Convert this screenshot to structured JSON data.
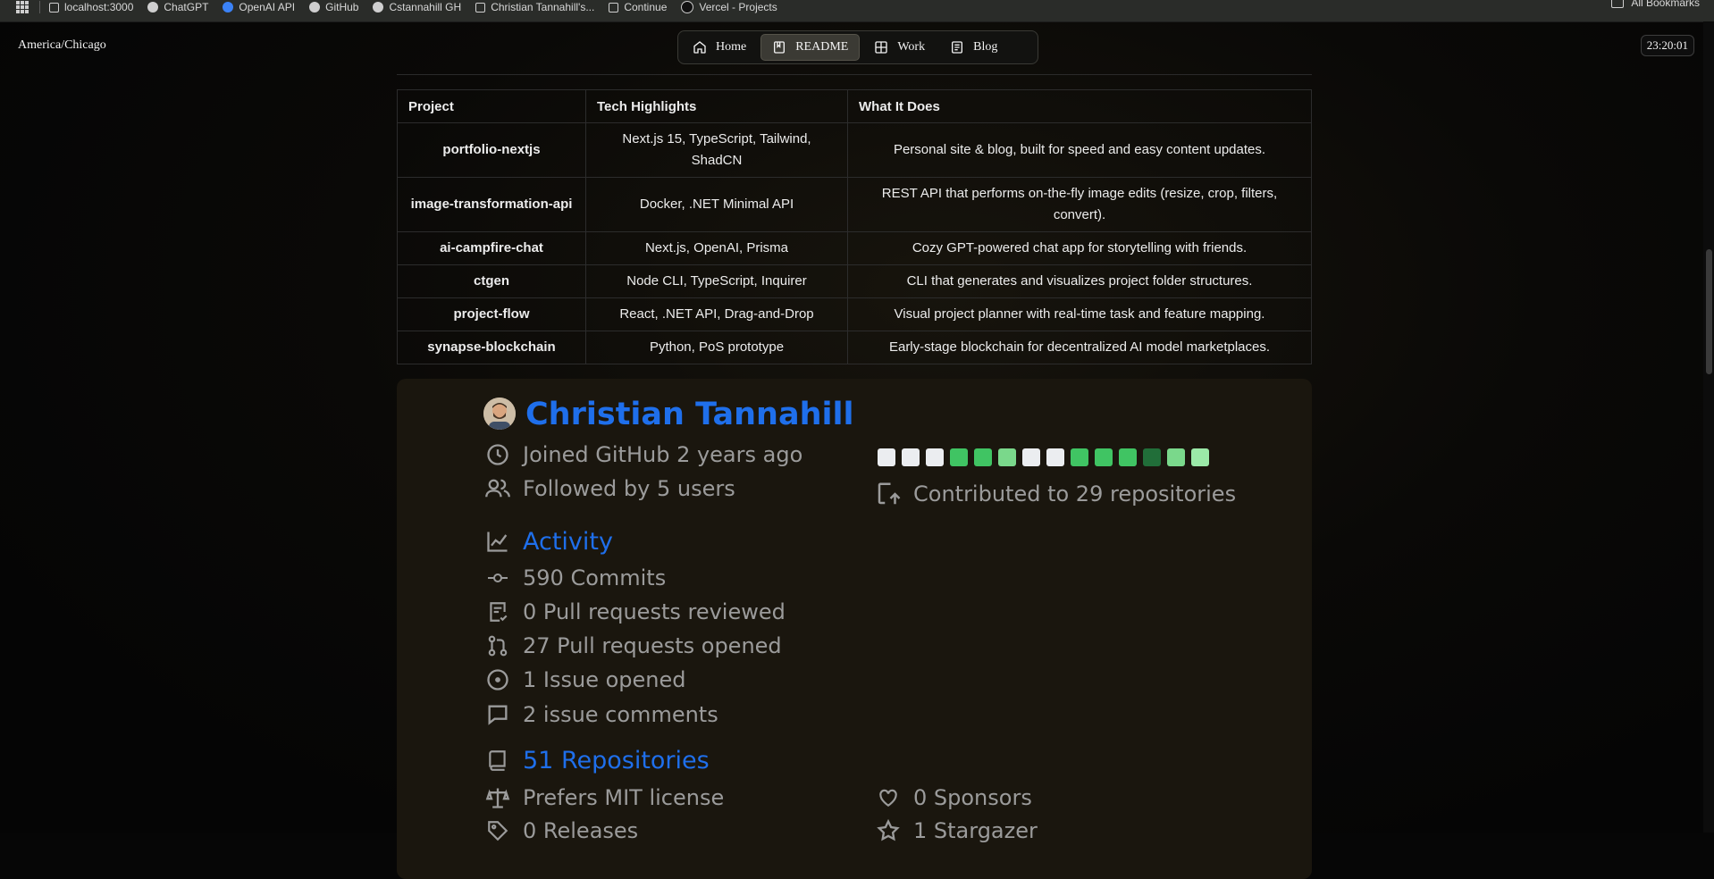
{
  "bookmarks": {
    "items": [
      {
        "label": "localhost:3000",
        "icon": "page-icon"
      },
      {
        "label": "ChatGPT",
        "icon": "openai-icon"
      },
      {
        "label": "OpenAI API",
        "icon": "openai-icon"
      },
      {
        "label": "GitHub",
        "icon": "github-icon"
      },
      {
        "label": "Cstannahill GH",
        "icon": "github-icon"
      },
      {
        "label": "Christian Tannahill's...",
        "icon": "page-icon"
      },
      {
        "label": "Continue",
        "icon": "continue-icon"
      },
      {
        "label": "Vercel - Projects",
        "icon": "vercel-icon"
      }
    ],
    "all_bookmarks": "All Bookmarks"
  },
  "header": {
    "timezone": "America/Chicago",
    "clock": "23:20:01",
    "nav": [
      {
        "label": "Home",
        "icon": "home-icon",
        "active": false
      },
      {
        "label": "README",
        "icon": "book-icon",
        "active": true
      },
      {
        "label": "Work",
        "icon": "grid-icon",
        "active": false
      },
      {
        "label": "Blog",
        "icon": "book-icon",
        "active": false
      }
    ]
  },
  "projects": {
    "headers": [
      "Project",
      "Tech Highlights",
      "What It Does"
    ],
    "rows": [
      [
        "portfolio-nextjs",
        "Next.js 15, TypeScript, Tailwind, ShadCN",
        "Personal site & blog, built for speed and easy content updates."
      ],
      [
        "image-transformation-api",
        "Docker, .NET Minimal API",
        "REST API that performs on-the-fly image edits (resize, crop, filters, convert)."
      ],
      [
        "ai-campfire-chat",
        "Next.js, OpenAI, Prisma",
        "Cozy GPT-powered chat app for storytelling with friends."
      ],
      [
        "ctgen",
        "Node CLI, TypeScript, Inquirer",
        "CLI that generates and visualizes project folder structures."
      ],
      [
        "project-flow",
        "React, .NET API, Drag-and-Drop",
        "Visual project planner with real-time task and feature mapping."
      ],
      [
        "synapse-blockchain",
        "Python, PoS prototype",
        "Early-stage blockchain for decentralized AI model marketplaces."
      ]
    ]
  },
  "github": {
    "name": "Christian Tannahill",
    "joined": "Joined GitHub 2 years ago",
    "followed": "Followed by 5 users",
    "contributed": "Contributed to 29 repositories",
    "contribution_levels": [
      0,
      0,
      0,
      3,
      3,
      2,
      0,
      0,
      3,
      3,
      3,
      4,
      2,
      1
    ],
    "activity": {
      "title": "Activity",
      "commits": "590 Commits",
      "prs_reviewed": "0 Pull requests reviewed",
      "prs_opened": "27 Pull requests opened",
      "issues_opened": "1 Issue opened",
      "issue_comments": "2 issue comments"
    },
    "repos": {
      "title": "51 Repositories",
      "license": "Prefers MIT license",
      "releases": "0 Releases",
      "sponsors": "0 Sponsors",
      "stargazer": "1 Stargazer"
    }
  },
  "colors": {
    "accent_blue": "#1f6feb",
    "contrib_empty": "#ebedf0",
    "contrib_1": "#9be9a8",
    "contrib_2": "#7ad88b",
    "contrib_3": "#40c463",
    "contrib_4": "#216e39"
  }
}
